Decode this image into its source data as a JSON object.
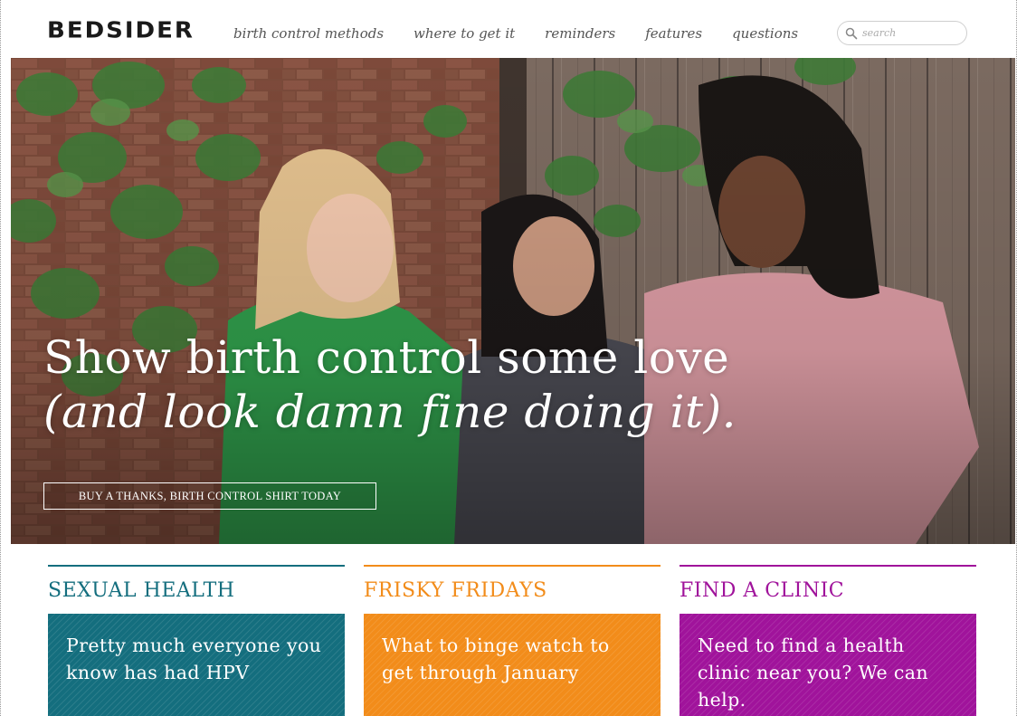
{
  "nav": {
    "logo": "BEDSIDER",
    "links": [
      "birth control methods",
      "where to get it",
      "reminders",
      "features",
      "questions"
    ],
    "search_placeholder": "search"
  },
  "hero": {
    "title_line1": "Show birth control some love",
    "title_line2": "(and look damn fine doing it).",
    "cta_label": "BUY A THANKS, BIRTH CONTROL SHIRT TODAY"
  },
  "columns": [
    {
      "heading": "SEXUAL HEALTH",
      "card_text": "Pretty much everyone you know has had HPV",
      "color": "#146e7e"
    },
    {
      "heading": "FRISKY FRIDAYS",
      "card_text": "What to binge watch to get through January",
      "color": "#f28c1a"
    },
    {
      "heading": "FIND A CLINIC",
      "card_text": "Need to find a health clinic near you? We can help.",
      "color": "#a0139b"
    }
  ]
}
